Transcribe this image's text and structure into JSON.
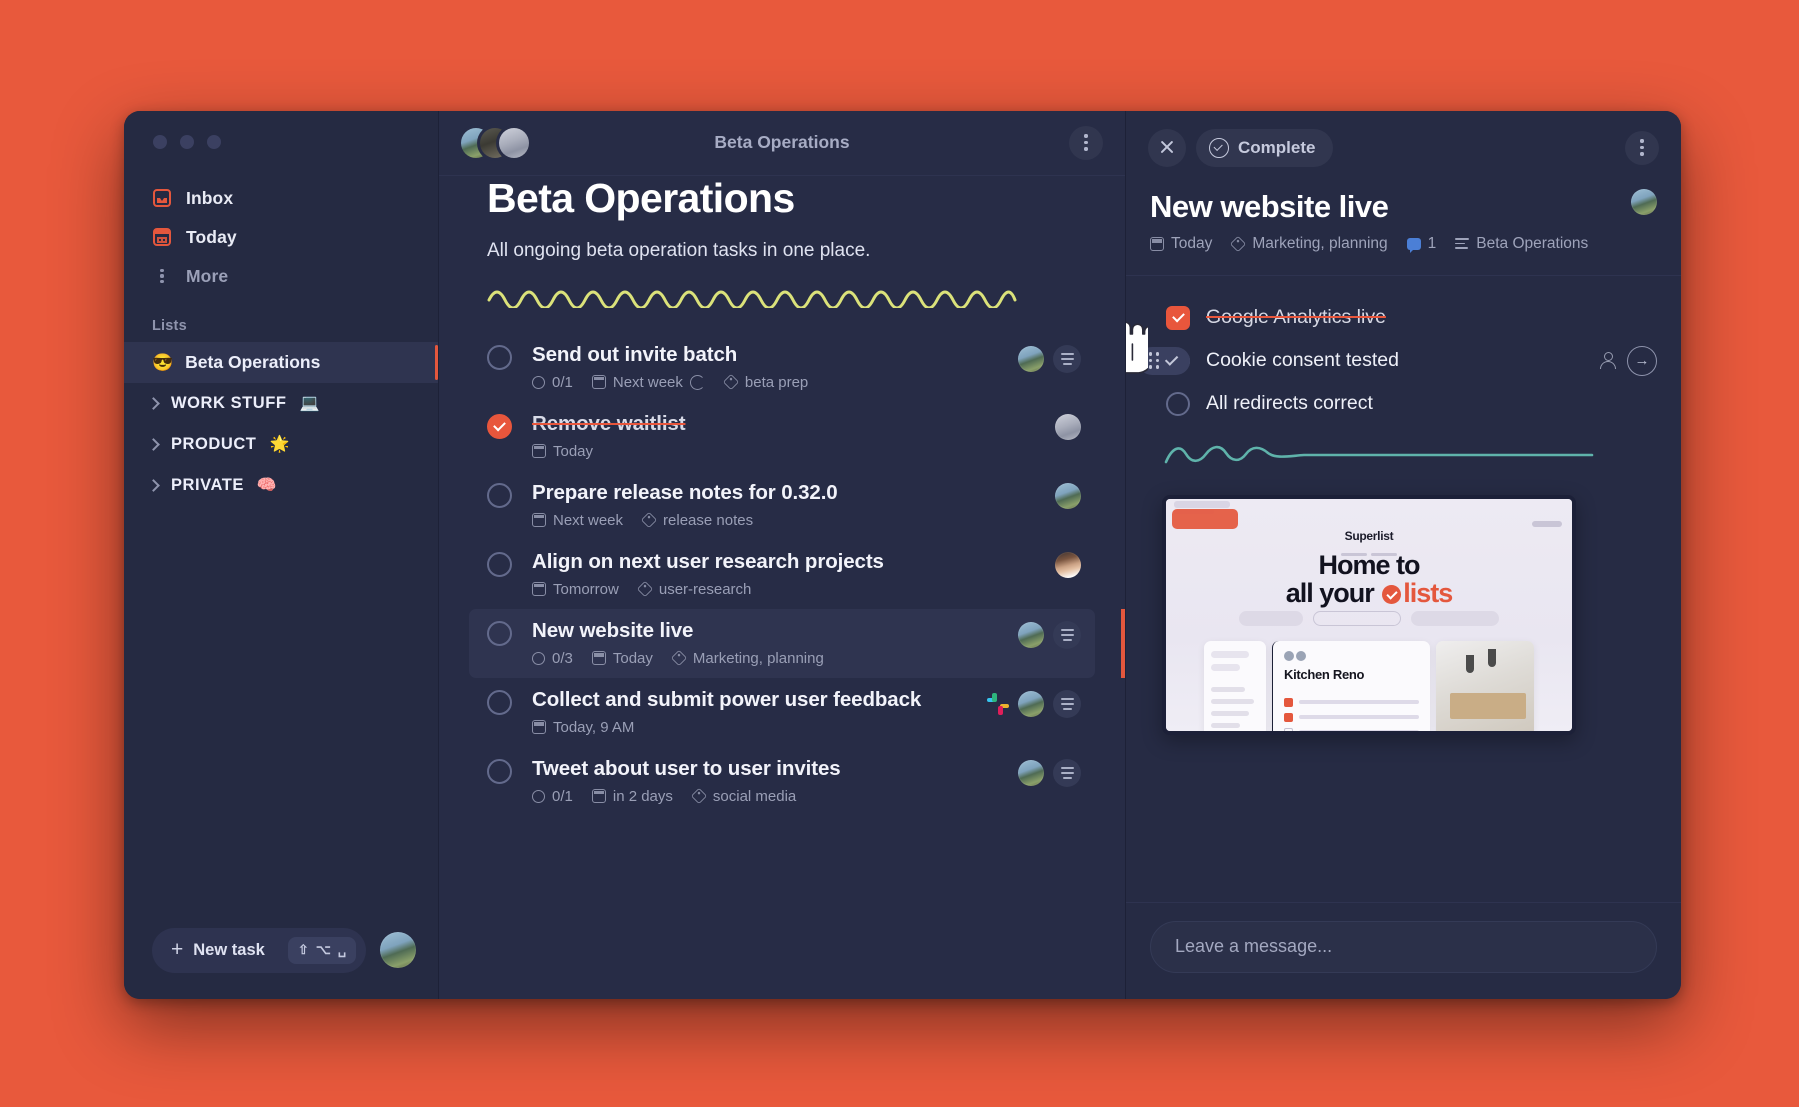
{
  "theme": {
    "desktop_bg": "#e8593c",
    "window_bg": "#242943",
    "accent": "#e8563c",
    "panel_bg": "#262b44",
    "teal": "#5fb3ab",
    "squiggle": "#dbe27a"
  },
  "sidebar": {
    "nav": [
      {
        "label": "Inbox",
        "icon": "inbox-icon"
      },
      {
        "label": "Today",
        "icon": "calendar-icon"
      },
      {
        "label": "More",
        "icon": "more-dots-icon"
      }
    ],
    "section_label": "Lists",
    "lists": [
      {
        "label": "Beta Operations",
        "emoji": "😎",
        "active": true
      },
      {
        "label": "WORK STUFF",
        "emoji": "💻",
        "group": true
      },
      {
        "label": "PRODUCT",
        "emoji": "🌟",
        "group": true
      },
      {
        "label": "PRIVATE",
        "emoji": "🧠",
        "group": true
      }
    ],
    "new_task": {
      "label": "New task",
      "plus": "+",
      "shortcut": [
        "⇧",
        "⌥",
        "␣"
      ]
    }
  },
  "middle": {
    "header_title": "Beta Operations",
    "page_title": "Beta Operations",
    "page_subtitle": "All ongoing beta operation tasks in one place.",
    "tasks": [
      {
        "title": "Send out invite batch",
        "done": false,
        "counter": "0/1",
        "date": "Next week",
        "repeat": true,
        "tag": "beta prep",
        "avatar": "a",
        "note": true,
        "slack": false,
        "selected": false
      },
      {
        "title": "Remove waitlist",
        "done": true,
        "counter": "",
        "date": "Today",
        "repeat": false,
        "tag": "",
        "avatar": "g",
        "note": false,
        "slack": false,
        "selected": false
      },
      {
        "title": "Prepare release notes for 0.32.0",
        "done": false,
        "counter": "",
        "date": "Next week",
        "repeat": false,
        "tag": "release notes",
        "avatar": "a",
        "note": false,
        "slack": false,
        "selected": false
      },
      {
        "title": "Align on next user research projects",
        "done": false,
        "counter": "",
        "date": "Tomorrow",
        "repeat": false,
        "tag": "user-research",
        "avatar": "f",
        "note": false,
        "slack": false,
        "selected": false
      },
      {
        "title": "New website live",
        "done": false,
        "counter": "0/3",
        "date": "Today",
        "repeat": false,
        "tag": "Marketing, planning",
        "avatar": "a",
        "note": true,
        "slack": false,
        "selected": true
      },
      {
        "title": "Collect and submit power user feedback",
        "done": false,
        "counter": "",
        "date": "Today, 9 AM",
        "repeat": false,
        "tag": "",
        "avatar": "a",
        "note": true,
        "slack": true,
        "selected": false
      },
      {
        "title": "Tweet about user to user invites",
        "done": false,
        "counter": "0/1",
        "date": "in 2 days",
        "repeat": false,
        "tag": "social media",
        "avatar": "a",
        "note": true,
        "slack": false,
        "selected": false
      }
    ]
  },
  "detail": {
    "complete_label": "Complete",
    "title": "New website live",
    "meta": {
      "date": "Today",
      "tags": "Marketing, planning",
      "comments": "1",
      "list": "Beta Operations"
    },
    "subtasks": [
      {
        "label": "Google Analytics live",
        "done": true,
        "shape": "square"
      },
      {
        "label": "Cookie consent tested",
        "done": false,
        "shape": "round",
        "hovered": true
      },
      {
        "label": "All redirects correct",
        "done": false,
        "shape": "round"
      }
    ],
    "preview": {
      "brand": "Superlist",
      "headline_line1": "Home to",
      "headline_line2_a": "all your",
      "headline_line2_b": "lists",
      "card_title": "Kitchen Reno"
    },
    "message_placeholder": "Leave a message..."
  }
}
